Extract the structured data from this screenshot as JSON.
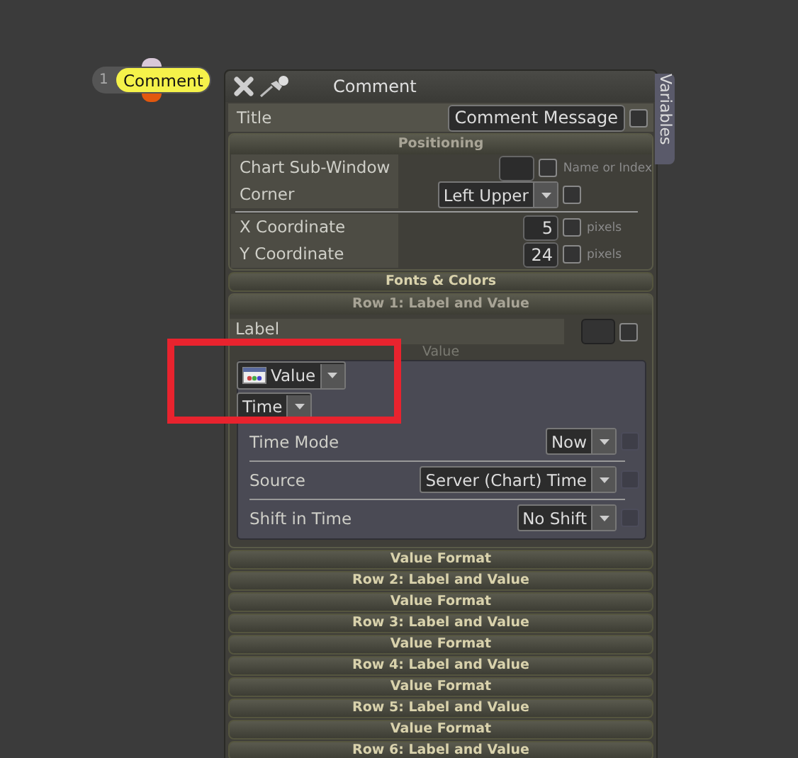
{
  "node": {
    "index": "1",
    "label": "Comment"
  },
  "panel": {
    "title": "Comment",
    "side_tab": "Variables",
    "title_row": {
      "label": "Title",
      "value": "Comment Message",
      "checked": false
    },
    "positioning": {
      "heading": "Positioning",
      "rows": [
        {
          "kind": "field",
          "label": "Chart Sub-Window",
          "checked": false,
          "unit": "Name or Index"
        },
        {
          "kind": "select",
          "label": "Corner",
          "value": "Left Upper",
          "checked": false
        },
        {
          "kind": "divider"
        },
        {
          "kind": "field",
          "label": "X Coordinate",
          "value": "5",
          "checked": false,
          "unit": "pixels"
        },
        {
          "kind": "field",
          "label": "Y Coordinate",
          "value": "24",
          "checked": false,
          "unit": "pixels"
        }
      ]
    },
    "fonts_heading": "Fonts & Colors",
    "row1": {
      "heading": "Row 1: Label and Value",
      "label": "Label",
      "label_checked": false,
      "value_heading": "Value",
      "popup": [
        {
          "kind": "icon",
          "value": "Value"
        },
        {
          "kind": "plain",
          "value": "Time"
        }
      ],
      "rows": [
        {
          "kind": "select",
          "label": "Time Mode",
          "value": "Now",
          "checked": false
        },
        {
          "kind": "divider"
        },
        {
          "kind": "select",
          "label": "Source",
          "value": "Server (Chart) Time",
          "checked": false
        },
        {
          "kind": "divider"
        },
        {
          "kind": "select",
          "label": "Shift in Time",
          "value": "No Shift",
          "checked": false
        }
      ]
    },
    "collapsed": [
      "Value Format",
      "Row 2: Label and Value",
      "Value Format",
      "Row 3: Label and Value",
      "Value Format",
      "Row 4: Label and Value",
      "Value Format",
      "Row 5: Label and Value",
      "Value Format",
      "Row 6: Label and Value"
    ]
  }
}
